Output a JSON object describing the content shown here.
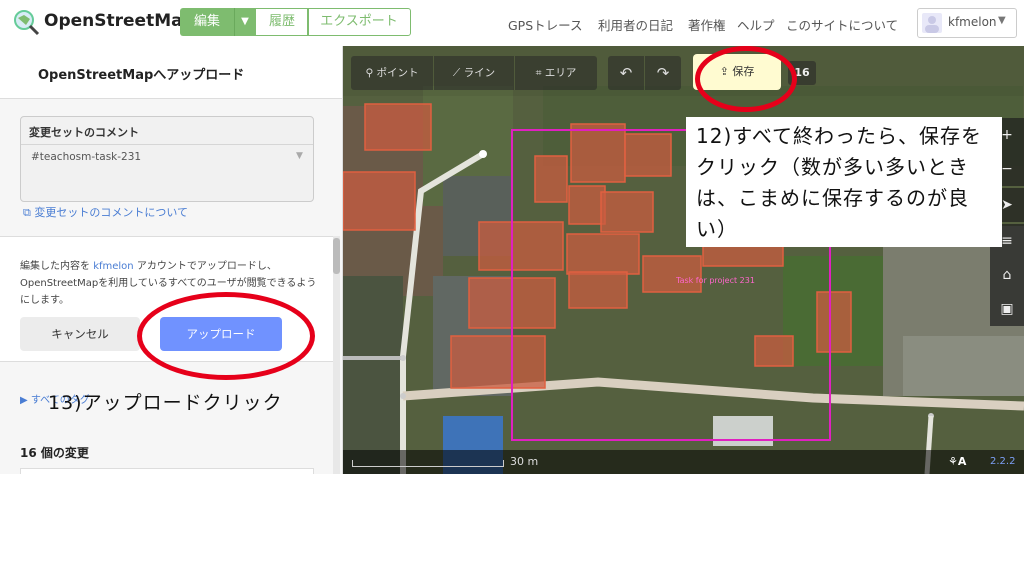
{
  "header": {
    "logo_text": "OpenStreetMap",
    "edit_label": "編集",
    "history_label": "履歴",
    "export_label": "エクスポート",
    "nav_links": [
      "GPSトレース",
      "利用者の日記",
      "著作権",
      "ヘルプ",
      "このサイトについて"
    ],
    "username": "kfmelon"
  },
  "sidebar": {
    "title": "OpenStreetMapへアップロード",
    "comment_label": "変更セットのコメント",
    "comment_value": "#teachosm-task-231",
    "comment_link": "変更セットのコメントについて",
    "info_prefix": "編集した内容を",
    "info_user": "kfmelon",
    "info_suffix": "アカウントでアップロードし、OpenStreetMapを利用しているすべてのユーザが閲覧できるようにします。",
    "cancel_label": "キャンセル",
    "upload_label": "アップロード",
    "tags_label": "すべてのタグ",
    "changes_title": "16 個の変更"
  },
  "toolbar": {
    "point_label": "ポイント",
    "line_label": "ライン",
    "area_label": "エリア",
    "save_label": "保存",
    "change_count": "16"
  },
  "map": {
    "scale_label": "30 m",
    "version": "2.2.2",
    "task_label": "Task for project 231"
  },
  "annotations": {
    "step12": "12)すべて終わったら、保存をクリック（数が多い多いときは、こまめに保存するのが良い）",
    "step13": "13)アップロードクリック"
  },
  "colors": {
    "osm_green": "#7ebc6f",
    "upload_blue": "#7092ff",
    "save_yellow": "#fffbd1",
    "annotation_red": "#e6001a",
    "task_magenta": "#e020c0",
    "building_outline": "#e06040"
  }
}
